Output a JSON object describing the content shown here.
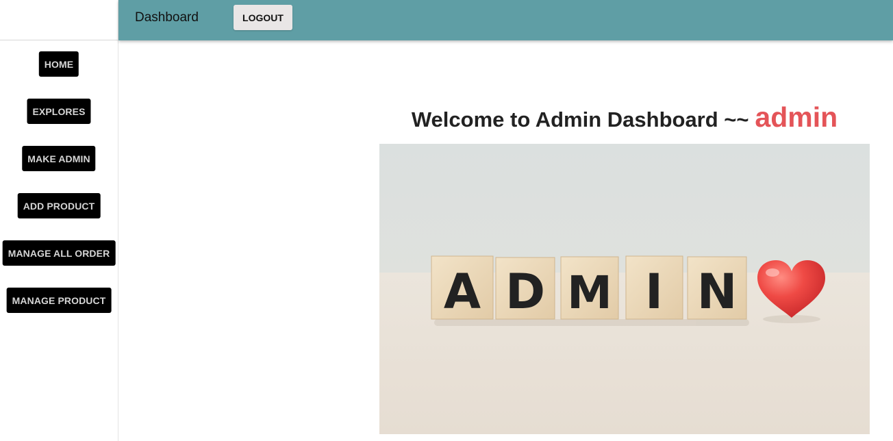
{
  "topbar": {
    "title": "Dashboard",
    "logout_label": "LOGOUT"
  },
  "sidebar": {
    "items": [
      {
        "label": "HOME"
      },
      {
        "label": "EXPLORES"
      },
      {
        "label": "MAKE ADMIN"
      },
      {
        "label": "ADD PRODUCT"
      },
      {
        "label": "MANAGE ALL ORDER"
      },
      {
        "label": "MANAGE PRODUCT"
      }
    ]
  },
  "main": {
    "welcome_text": "Welcome to Admin Dashboard ~~",
    "username": "admin",
    "hero_image": {
      "blocks": [
        "A",
        "D",
        "M",
        "I",
        "N"
      ],
      "icon": "heart-icon"
    }
  },
  "colors": {
    "topbar": "#5f9ea5",
    "nav_button_bg": "#000000",
    "nav_button_text": "#d6d6d6",
    "username_accent": "#e45458",
    "logout_bg": "#e9e6e6"
  }
}
